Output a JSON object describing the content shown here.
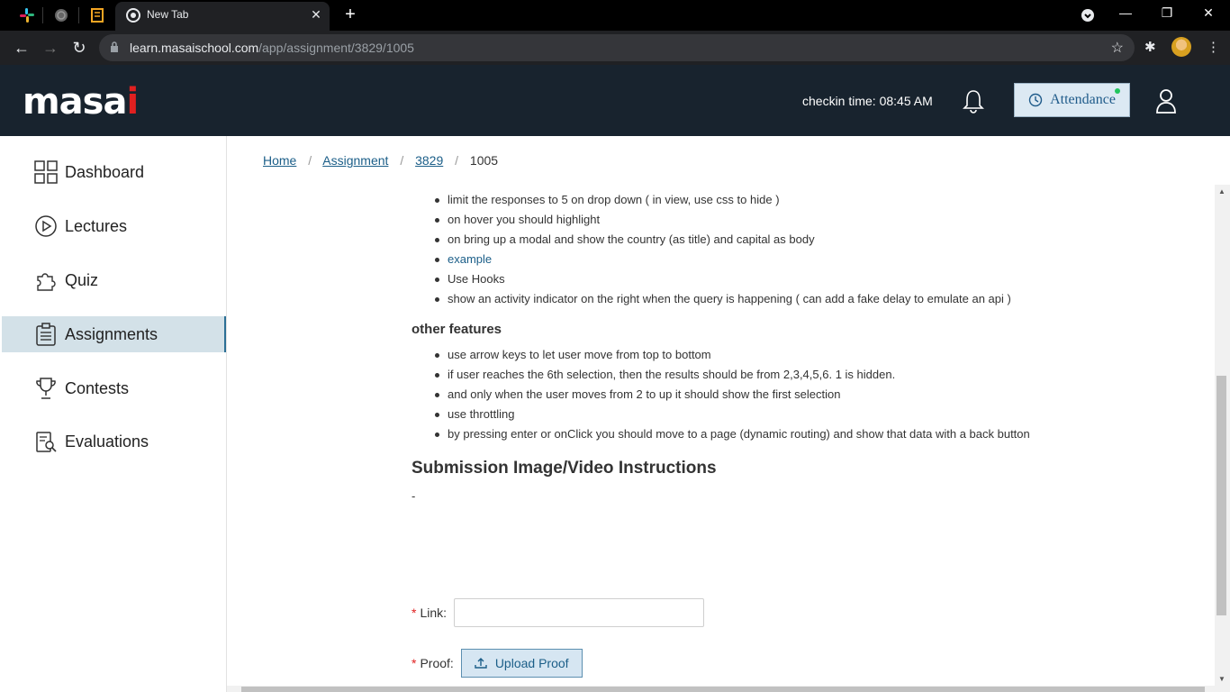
{
  "browser": {
    "tab_title": "New Tab",
    "tab_close": "✕",
    "new_tab": "+",
    "url_host": "learn.masaischool.com",
    "url_path": "/app/assignment/3829/1005",
    "window_controls": [
      "—",
      "❐",
      "✕"
    ]
  },
  "header": {
    "logo_text": "masa",
    "logo_dot": "i",
    "checkin": "checkin time: 08:45 AM",
    "attendance_label": "Attendance"
  },
  "sidebar": {
    "items": [
      {
        "label": "Dashboard",
        "icon": "grid-icon"
      },
      {
        "label": "Lectures",
        "icon": "play-circle-icon"
      },
      {
        "label": "Quiz",
        "icon": "puzzle-icon"
      },
      {
        "label": "Assignments",
        "icon": "clipboard-icon",
        "active": true
      },
      {
        "label": "Contests",
        "icon": "trophy-icon"
      },
      {
        "label": "Evaluations",
        "icon": "evaluation-icon"
      }
    ]
  },
  "breadcrumb": {
    "home": "Home",
    "assignment": "Assignment",
    "id": "3829",
    "current": "1005",
    "sep": "/"
  },
  "content": {
    "top_list": [
      "limit the responses to 5 on drop down ( in view, use css to hide )",
      "on hover you should highlight",
      "on bring up a modal and show the country (as title) and capital as body",
      "example",
      "Use Hooks",
      "show an activity indicator on the right when the query is happening ( can add a fake delay to emulate an api )"
    ],
    "other_features_heading": "other features",
    "other_features": [
      "use arrow keys to let user move from top to bottom",
      "if user reaches the 6th selection, then the results should be from 2,3,4,5,6. 1 is hidden.",
      "and only when the user moves from 2 to up it should show the first selection",
      "use throttling",
      "by pressing enter or onClick you should move to a page (dynamic routing) and show that data with a back button"
    ],
    "submission_heading": "Submission Image/Video Instructions",
    "submission_text": "-"
  },
  "form": {
    "link_label": "Link:",
    "link_value": "",
    "proof_label": "Proof:",
    "upload_label": "Upload Proof",
    "required_mark": "*"
  },
  "colors": {
    "header_bg": "#18232e",
    "accent": "#1b5e88",
    "active_sidebar": "#d3e1e8"
  }
}
